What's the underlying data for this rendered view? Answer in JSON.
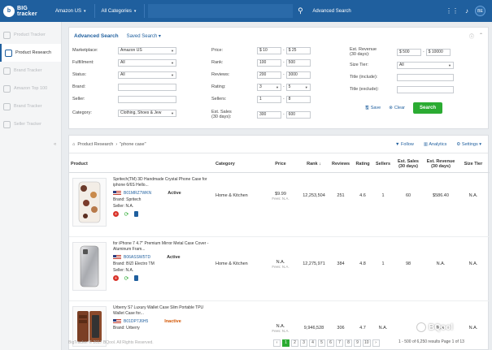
{
  "topbar": {
    "logo_line1": "BIG",
    "logo_line2": "tracker",
    "marketplace": "Amazon US",
    "categories": "All Categories",
    "advanced_search": "Advanced Search",
    "avatar": "BE"
  },
  "sidebar": {
    "items": [
      {
        "label": "Product Tracker"
      },
      {
        "label": "Product Research"
      },
      {
        "label": "Brand Tracker"
      },
      {
        "label": "Amazon Top 100"
      },
      {
        "label": "Brand Tracker"
      },
      {
        "label": "Seller Tracker"
      }
    ]
  },
  "panel": {
    "title": "Advanced Search",
    "saved_search": "Saved Search ▾",
    "fields": {
      "marketplace_label": "Marketplace:",
      "marketplace_value": "Amazon US",
      "fulfillment_label": "Fulfillment:",
      "fulfillment_value": "All",
      "status_label": "Status:",
      "status_value": "All",
      "brand_label": "Brand:",
      "seller_label": "Seller:",
      "category_label": "Category:",
      "category_value": "Clothing, Shoes & Jew",
      "price_label": "Price:",
      "price_min": "$ 10",
      "price_max": "$ 25",
      "rank_label": "Rank:",
      "rank_min": "100",
      "rank_max": "500",
      "reviews_label": "Reviews:",
      "reviews_min": "200",
      "reviews_max": "3000",
      "rating_label": "Rating:",
      "rating_min": "3",
      "rating_max": "5",
      "sellers_label": "Sellers:",
      "sellers_min": "1",
      "sellers_max": "8",
      "est_sales_label": "Est. Sales",
      "est_sales_sub": "(30 days):",
      "est_sales_min": "300",
      "est_sales_max": "600",
      "est_rev_label": "Est. Revenue",
      "est_rev_sub": "(30 days):",
      "est_rev_min": "$ 500",
      "est_rev_max": "$ 10000",
      "size_tier_label": "Size Tier:",
      "size_tier_value": "All",
      "title_include_label": "Title (include):",
      "title_exclude_label": "Title (exclude):"
    },
    "save_label": "Save",
    "clear_label": "Clear",
    "search_label": "Search"
  },
  "results": {
    "crumb_root": "Product Research",
    "crumb_query": "\"phone case\"",
    "follow": "Follow",
    "analytics": "Analytics",
    "settings": "Settings ▾",
    "headers": {
      "product": "Product",
      "category": "Category",
      "price": "Price",
      "rank": "Rank",
      "reviews": "Reviews",
      "rating": "Rating",
      "sellers": "Sellers",
      "est_sales": "Est. Sales (30 days)",
      "est_revenue": "Est. Revenue (30 days)",
      "size_tier": "Size Tier"
    },
    "rows": [
      {
        "title": "Spritech(TM) 3D Handmade Crystal Phone Case for iphone 6/6S Hello...",
        "asin": "B01MRZ7WKN",
        "status": "Active",
        "brand": "Brand: Spritech",
        "seller": "Seller: N.A.",
        "category": "Home & Kitchen",
        "price": "$9.99",
        "price_sub": "Fees: N.A.",
        "rank": "12,253,504",
        "reviews": "251",
        "rating": "4.6",
        "sellers": "1",
        "est_sales": "60",
        "est_revenue": "$586.40",
        "size_tier": "N.A."
      },
      {
        "title": "for iPhone 7 4.7\" Premium Mirror Metal Case Cover - Aluminum Fram...",
        "asin": "B06ASSW5TD",
        "status": "Active",
        "brand": "Brand: BIZI Electro TM",
        "seller": "Seller: N.A.",
        "category": "Home & Kitchen",
        "price": "N.A.",
        "price_sub": "Fees: N.A.",
        "rank": "12,275,971",
        "reviews": "384",
        "rating": "4.8",
        "sellers": "1",
        "est_sales": "98",
        "est_revenue": "N.A.",
        "size_tier": "N.A."
      },
      {
        "title": "Urberry S7 Luxury Wallet Case Slim Portable TPU Wallet Case for...",
        "asin": "B01DP7J6H5",
        "status": "Inactive",
        "brand": "Brand: Urberry",
        "seller": "",
        "category": "",
        "price": "N.A.",
        "price_sub": "Fees: N.A.",
        "rank": "9,946,528",
        "reviews": "306",
        "rating": "4.7",
        "sellers": "N.A.",
        "est_sales": "",
        "est_revenue": "N.A.",
        "size_tier": "N.A."
      }
    ]
  },
  "pagination": {
    "pages": [
      "‹",
      "1",
      "2",
      "3",
      "4",
      "5",
      "6",
      "7",
      "8",
      "9",
      "10",
      "›"
    ],
    "info": "1 - 500 of 6,250 results  Page 1 of 13"
  },
  "footer": "BigTracker © 2017 BQool. All Rights Reserved.",
  "watermark": "BQool"
}
